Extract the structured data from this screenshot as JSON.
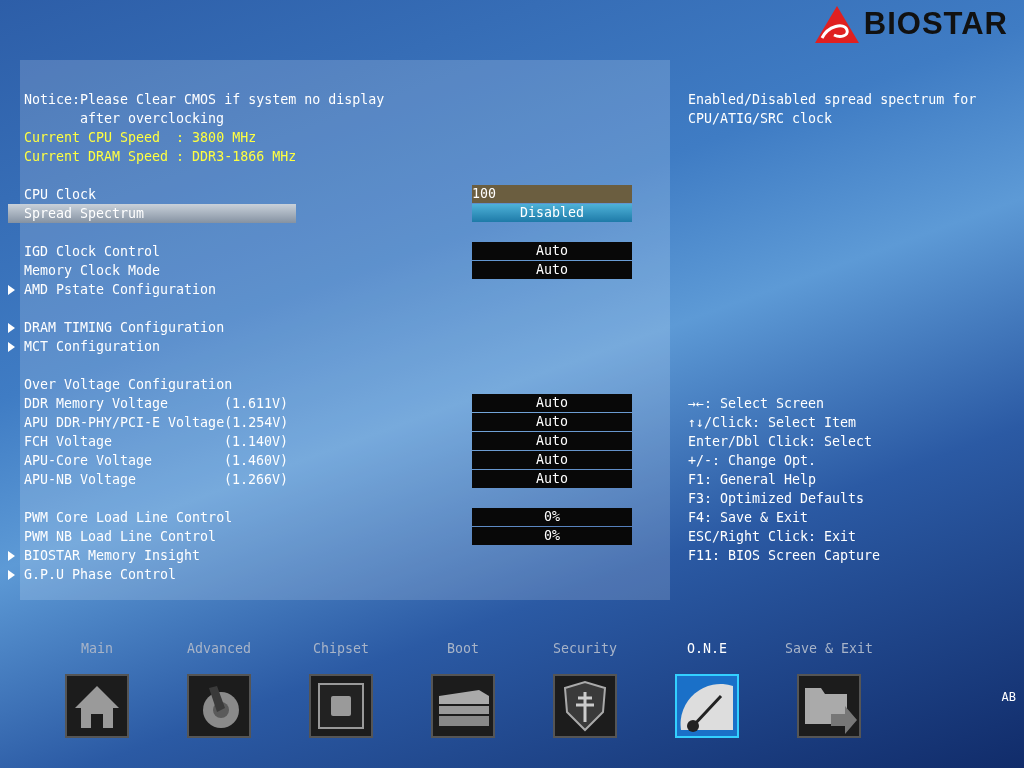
{
  "logo": {
    "brand": "BIOSTAR"
  },
  "settings": [
    {
      "kind": "notice",
      "text": "Notice:Please Clear CMOS if system no display after overclocking"
    },
    {
      "kind": "info",
      "text": "Current CPU Speed  : 3800 MHz"
    },
    {
      "kind": "info",
      "text": "Current DRAM Speed : DDR3-1866 MHz"
    },
    {
      "kind": "gap"
    },
    {
      "kind": "field",
      "label": "CPU Clock",
      "value": "100",
      "selected": false
    },
    {
      "kind": "option",
      "label": "Spread Spectrum",
      "value": "Disabled",
      "selected": true
    },
    {
      "kind": "gap"
    },
    {
      "kind": "option",
      "label": "IGD Clock Control",
      "value": "Auto",
      "selected": false
    },
    {
      "kind": "option",
      "label": "Memory Clock Mode",
      "value": "Auto",
      "selected": false
    },
    {
      "kind": "submenu",
      "label": "AMD Pstate Configuration",
      "selected": false
    },
    {
      "kind": "gap"
    },
    {
      "kind": "submenu",
      "label": "DRAM TIMING Configuration",
      "selected": false
    },
    {
      "kind": "submenu",
      "label": "MCT Configuration",
      "selected": false
    },
    {
      "kind": "gap"
    },
    {
      "kind": "heading",
      "text": "Over Voltage Configuration"
    },
    {
      "kind": "option",
      "label": "DDR Memory Voltage",
      "reading": "(1.611V)",
      "value": "Auto",
      "selected": false
    },
    {
      "kind": "option",
      "label": "APU DDR-PHY/PCI-E Voltage",
      "reading": "(1.254V)",
      "value": "Auto",
      "selected": false
    },
    {
      "kind": "option",
      "label": "FCH Voltage",
      "reading": "(1.140V)",
      "value": "Auto",
      "selected": false
    },
    {
      "kind": "option",
      "label": "APU-Core Voltage",
      "reading": "(1.460V)",
      "value": "Auto",
      "selected": false
    },
    {
      "kind": "option",
      "label": "APU-NB Voltage",
      "reading": "(1.266V)",
      "value": "Auto",
      "selected": false
    },
    {
      "kind": "gap"
    },
    {
      "kind": "option",
      "label": "PWM Core Load Line Control",
      "value": "0%",
      "selected": false
    },
    {
      "kind": "option",
      "label": "PWM NB Load Line Control",
      "value": "0%",
      "selected": false
    },
    {
      "kind": "submenu",
      "label": "BIOSTAR Memory Insight",
      "selected": false
    },
    {
      "kind": "submenu",
      "label": "G.P.U Phase Control",
      "selected": false
    }
  ],
  "help": {
    "description": "Enabled/Disabled spread spectrum for CPU/ATIG/SRC clock",
    "keys": [
      "→←: Select Screen",
      "↑↓/Click: Select Item",
      "Enter/Dbl Click: Select",
      "+/-: Change Opt.",
      "F1: General Help",
      "F3: Optimized Defaults",
      "F4: Save & Exit",
      "ESC/Right Click: Exit",
      "F11: BIOS Screen Capture"
    ]
  },
  "tabs": [
    {
      "label": "Main",
      "kind": "home",
      "selected": false
    },
    {
      "label": "Advanced",
      "kind": "knob",
      "selected": false
    },
    {
      "label": "Chipset",
      "kind": "chip",
      "selected": false
    },
    {
      "label": "Boot",
      "kind": "drives",
      "selected": false
    },
    {
      "label": "Security",
      "kind": "shield",
      "selected": false
    },
    {
      "label": "O.N.E",
      "kind": "gauge",
      "selected": true
    },
    {
      "label": "Save & Exit",
      "kind": "folder",
      "selected": false
    }
  ],
  "corner_label": "AB"
}
